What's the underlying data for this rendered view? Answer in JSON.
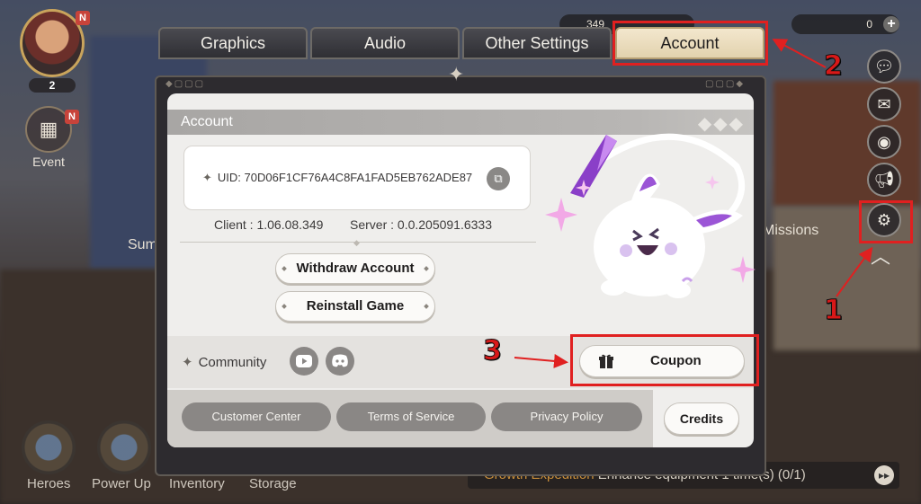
{
  "hud": {
    "player_level": "2",
    "event_label": "Event",
    "badge": "N",
    "currency_1": "349",
    "currency_2": "0",
    "missions_label": "Missions",
    "summon_label": "Sum"
  },
  "bottom_nav": [
    {
      "label": "Heroes"
    },
    {
      "label": "Power Up"
    },
    {
      "label": "Inventory"
    },
    {
      "label": "Storage"
    }
  ],
  "quest_bar": {
    "prefix": "Growth Expedition",
    "text": "Enhance equipment 1 time(s) (0/1)"
  },
  "tabs": [
    {
      "label": "Graphics",
      "active": false
    },
    {
      "label": "Audio",
      "active": false
    },
    {
      "label": "Other Settings",
      "active": false
    },
    {
      "label": "Account",
      "active": true
    }
  ],
  "account": {
    "section_title": "Account",
    "uid_text": "UID: 70D06F1CF76A4C8FA1FAD5EB762ADE87",
    "client_version": "Client : 1.06.08.349",
    "server_version": "Server : 0.0.205091.6333",
    "withdraw_label": "Withdraw Account",
    "reinstall_label": "Reinstall Game",
    "community_label": "Community",
    "coupon_label": "Coupon",
    "customer_center_label": "Customer Center",
    "terms_label": "Terms of Service",
    "privacy_label": "Privacy Policy",
    "credits_label": "Credits"
  },
  "annotations": {
    "step_1": "1",
    "step_2": "2",
    "step_3": "3",
    "color": "#e02020"
  }
}
